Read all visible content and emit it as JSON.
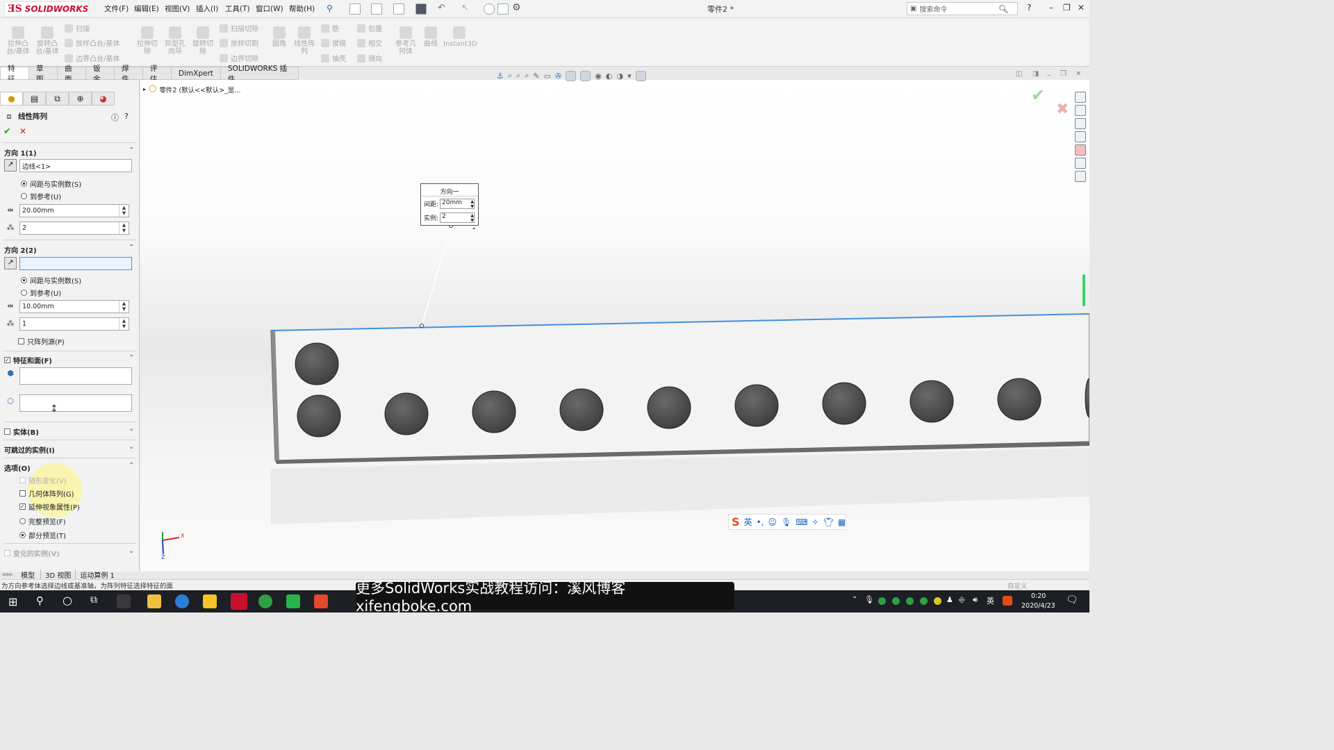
{
  "app": {
    "brand": "SOLIDWORKS",
    "title": "零件2 *",
    "menus": [
      "文件(F)",
      "编辑(E)",
      "视图(V)",
      "插入(I)",
      "工具(T)",
      "窗口(W)",
      "帮助(H)"
    ],
    "search_placeholder": "搜索命令"
  },
  "command_manager": {
    "big_buttons": [
      "拉伸凸\n台/基体",
      "旋转凸\n台/基体",
      "拉伸切\n除",
      "异型孔\n向导",
      "旋转切\n除",
      "圆角",
      "线性阵\n列",
      "参考几\n何体",
      "曲线",
      "Instant3D"
    ],
    "small_buttons": [
      "扫描",
      "放样凸台/基体",
      "边界凸台/基体",
      "扫描切除",
      "放样切割",
      "边界切除",
      "筋",
      "拔模",
      "抽壳",
      "包覆",
      "相交",
      "镜向"
    ]
  },
  "tabs": [
    "特征",
    "草图",
    "曲面",
    "钣金",
    "焊件",
    "评估",
    "DimXpert",
    "SOLIDWORKS 插件"
  ],
  "active_tab": "特征",
  "property_manager": {
    "title": "线性阵列",
    "direction1": {
      "header": "方向 1(1)",
      "edge_value": "边线<1>",
      "radio_spacing": "间距与实例数(S)",
      "radio_ref": "到参考(U)",
      "spacing": "20.00mm",
      "instances": "2"
    },
    "direction2": {
      "header": "方向 2(2)",
      "edge_value": "",
      "radio_spacing": "间距与实例数(S)",
      "radio_ref": "到参考(U)",
      "spacing": "10.00mm",
      "instances": "1",
      "pattern_seed_only": "只阵列源(P)"
    },
    "features_faces": {
      "header": "特征和面(F)"
    },
    "bodies": {
      "header": "实体(B)"
    },
    "skip_instances": {
      "header": "可跳过的实例(I)"
    },
    "options": {
      "header": "选项(O)",
      "vary_sketch": "随形变化(V)",
      "geometry_pattern": "几何体阵列(G)",
      "propagate_visual": "延伸视象属性(P)",
      "full_preview": "完整预览(F)",
      "partial_preview": "部分预览(T)"
    },
    "varied_instances": {
      "header": "变化的实例(V)"
    }
  },
  "tree": {
    "crumb": "零件2 (默认<<默认>_显..."
  },
  "callout": {
    "title": "方向一",
    "spacing_label": "间距:",
    "spacing_value": "20mm",
    "instances_label": "实例:",
    "instances_value": "2"
  },
  "bottom_tabs": [
    "模型",
    "3D 视图",
    "运动算例 1"
  ],
  "status_text": "为方向参考体选择边线或基准轴，为阵列特征选择特征的面",
  "status_right": "自定义",
  "subtitle": "更多SolidWorks实战教程访问：溪风博客xifengboke.com",
  "ime": {
    "lang": "英"
  },
  "taskbar": {
    "time": "0:20",
    "date": "2020/4/23",
    "ime_tray": "英"
  },
  "axis": {
    "x": "X",
    "z": "Z"
  },
  "colors": {
    "brand": "#c8102e",
    "selection_edge": "#3f8fe0",
    "accept": "#2e9b2e",
    "cancel": "#cc2020"
  }
}
